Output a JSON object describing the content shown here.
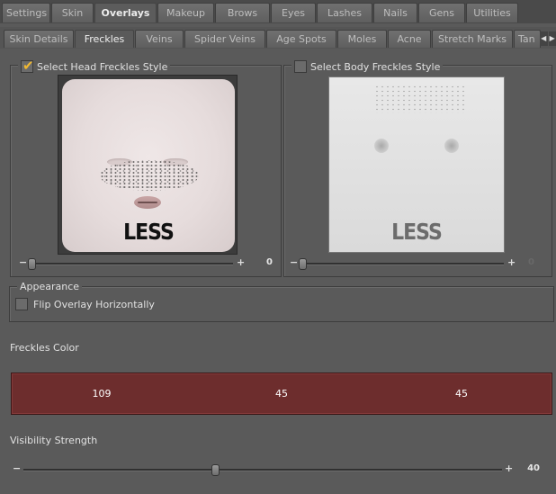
{
  "top_tabs": [
    {
      "label": "Settings",
      "active": false
    },
    {
      "label": "Skin",
      "active": false
    },
    {
      "label": "Overlays",
      "active": true
    },
    {
      "label": "Makeup",
      "active": false
    },
    {
      "label": "Brows",
      "active": false
    },
    {
      "label": "Eyes",
      "active": false
    },
    {
      "label": "Lashes",
      "active": false
    },
    {
      "label": "Nails",
      "active": false
    },
    {
      "label": "Gens",
      "active": false
    },
    {
      "label": "Utilities",
      "active": false
    }
  ],
  "sub_tabs": [
    {
      "label": "Skin Details",
      "active": false
    },
    {
      "label": "Freckles",
      "active": true
    },
    {
      "label": "Veins",
      "active": false
    },
    {
      "label": "Spider Veins",
      "active": false
    },
    {
      "label": "Age Spots",
      "active": false
    },
    {
      "label": "Moles",
      "active": false
    },
    {
      "label": "Acne",
      "active": false
    },
    {
      "label": "Stretch Marks",
      "active": false
    },
    {
      "label": "Tan",
      "active": false
    }
  ],
  "head_style": {
    "label": "Select Head Freckles Style",
    "checked": true,
    "thumbnail_text": "LESS",
    "slider_value": "0",
    "slider_fraction": 0.0
  },
  "body_style": {
    "label": "Select Body Freckles Style",
    "checked": false,
    "thumbnail_text": "LESS",
    "slider_value": "0",
    "slider_fraction": 0.0
  },
  "appearance": {
    "legend": "Appearance",
    "flip_label": "Flip Overlay Horizontally",
    "flip_checked": false
  },
  "freckles_color": {
    "title": "Freckles Color",
    "r": "109",
    "g": "45",
    "b": "45",
    "swatch": "#6d2d2d"
  },
  "visibility": {
    "title": "Visibility Strength",
    "value": "40",
    "fraction": 0.4
  },
  "colors": {
    "panel_bg": "#5a5a5a",
    "checkmark": "#f0b830"
  }
}
